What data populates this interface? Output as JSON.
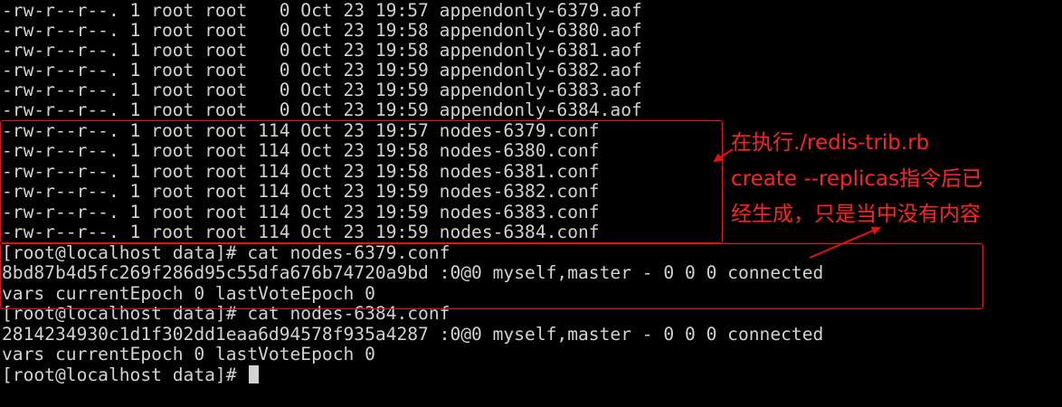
{
  "terminal": {
    "lines": [
      "-rw-r--r--. 1 root root   0 Oct 23 19:57 appendonly-6379.aof",
      "-rw-r--r--. 1 root root   0 Oct 23 19:58 appendonly-6380.aof",
      "-rw-r--r--. 1 root root   0 Oct 23 19:58 appendonly-6381.aof",
      "-rw-r--r--. 1 root root   0 Oct 23 19:59 appendonly-6382.aof",
      "-rw-r--r--. 1 root root   0 Oct 23 19:59 appendonly-6383.aof",
      "-rw-r--r--. 1 root root   0 Oct 23 19:59 appendonly-6384.aof",
      "-rw-r--r--. 1 root root 114 Oct 23 19:57 nodes-6379.conf",
      "-rw-r--r--. 1 root root 114 Oct 23 19:58 nodes-6380.conf",
      "-rw-r--r--. 1 root root 114 Oct 23 19:58 nodes-6381.conf",
      "-rw-r--r--. 1 root root 114 Oct 23 19:59 nodes-6382.conf",
      "-rw-r--r--. 1 root root 114 Oct 23 19:59 nodes-6383.conf",
      "-rw-r--r--. 1 root root 114 Oct 23 19:59 nodes-6384.conf",
      "[root@localhost data]# cat nodes-6379.conf",
      "8bd87b4d5fc269f286d95c55dfa676b74720a9bd :0@0 myself,master - 0 0 0 connected",
      "vars currentEpoch 0 lastVoteEpoch 0",
      "[root@localhost data]# cat nodes-6384.conf",
      "2814234930c1d1f302dd1eaa6d94578f935a4287 :0@0 myself,master - 0 0 0 connected",
      "vars currentEpoch 0 lastVoteEpoch 0",
      "[root@localhost data]# "
    ]
  },
  "annotation": {
    "lines": [
      "在执行./redis-trib.rb",
      "create --replicas指令后已",
      "经生成，只是当中没有内容"
    ],
    "color": "#ff2222"
  },
  "colors": {
    "background": "#000000",
    "text": "#d2d2d2",
    "highlight_box": "#e81010"
  }
}
